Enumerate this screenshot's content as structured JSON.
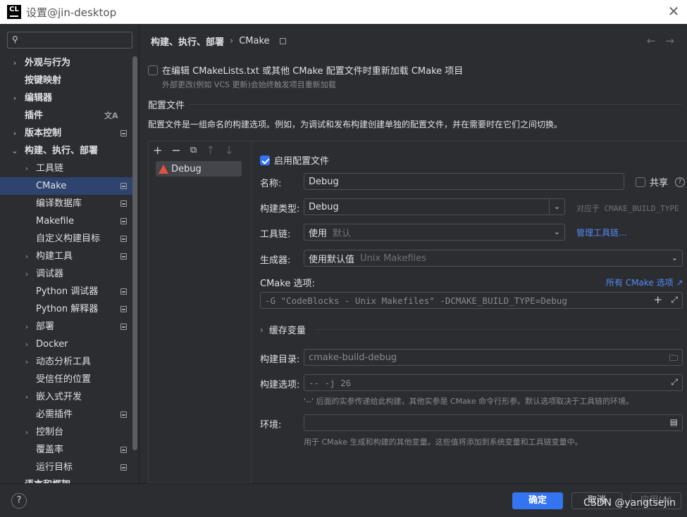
{
  "window": {
    "logo": "CL",
    "title": "设置@jin-desktop",
    "close_glyph": "✕"
  },
  "sidebar": {
    "search_placeholder": "",
    "items": [
      {
        "label": "外观与行为",
        "chevron": "›",
        "bold": true
      },
      {
        "label": "按键映射",
        "bold": true
      },
      {
        "label": "编辑器",
        "chevron": "›",
        "bold": true
      },
      {
        "label": "插件",
        "bold": true,
        "lang_icon": "文A"
      },
      {
        "label": "版本控制",
        "chevron": "›",
        "bold": true
      },
      {
        "label": "构建、执行、部署",
        "chevron": "⌄",
        "bold": true
      },
      {
        "label": "工具链",
        "chevron": "›"
      },
      {
        "label": "CMake",
        "selected": true
      },
      {
        "label": "编译数据库"
      },
      {
        "label": "Makefile"
      },
      {
        "label": "自定义构建目标"
      },
      {
        "label": "构建工具",
        "chevron": "›"
      },
      {
        "label": "调试器",
        "chevron": "›"
      },
      {
        "label": "Python 调试器"
      },
      {
        "label": "Python 解释器"
      },
      {
        "label": "部署",
        "chevron": "›"
      },
      {
        "label": "Docker",
        "chevron": "›"
      },
      {
        "label": "动态分析工具",
        "chevron": "›"
      },
      {
        "label": "受信任的位置"
      },
      {
        "label": "嵌入式开发",
        "chevron": "›"
      },
      {
        "label": "必需插件"
      },
      {
        "label": "控制台",
        "chevron": "›"
      },
      {
        "label": "覆盖率"
      },
      {
        "label": "运行目标"
      },
      {
        "label": "语言和框架",
        "chevron": "›",
        "bold": true
      }
    ]
  },
  "breadcrumb": {
    "parent": "构建、执行、部署",
    "separator": "›",
    "current": "CMake",
    "back": "←",
    "forward": "→"
  },
  "reload": {
    "label": "在编辑 CMakeLists.txt 或其他 CMake 配置文件时重新加载 CMake 项目",
    "hint": "外部更改(例如 VCS 更新)会始终触发项目重新加载",
    "checked": false
  },
  "profiles_section": {
    "title": "配置文件",
    "description": "配置文件是一组命名的构建选项。例如，为调试和发布构建创建单独的配置文件，并在需要时在它们之间切换。",
    "toolbar": {
      "add": "+",
      "remove": "−",
      "copy": "⧉",
      "up": "↑",
      "down": "↓"
    },
    "profiles": [
      "Debug"
    ]
  },
  "profile": {
    "enable_label": "启用配置文件",
    "enabled": true,
    "name_label": "名称:",
    "name_value": "Debug",
    "share_label": "共享",
    "share_help": "?",
    "build_type_label": "构建类型:",
    "build_type_value": "Debug",
    "build_type_note": "对应于 CMAKE_BUILD_TYPE",
    "toolchain_label": "工具链:",
    "toolchain_value": "使用",
    "toolchain_default": "默认",
    "manage_toolchains": "管理工具链...",
    "generator_label": "生成器:",
    "generator_value": "使用默认值",
    "generator_sub": "Unix Makefiles",
    "cmake_options_label": "CMake 选项:",
    "all_cmake_options": "所有 CMake 选项 ↗",
    "cmake_options_value": "-G \"CodeBlocks - Unix Makefiles\" -DCMAKE_BUILD_TYPE=Debug",
    "cache_vars_label": "缓存变量",
    "build_dir_label": "构建目录:",
    "build_dir_value": "cmake-build-debug",
    "build_options_label": "构建选项:",
    "build_options_value": "-- -j 26",
    "build_options_hint": "'--' 后面的实参传递给此构建，其他实参是 CMake 命令行形参。默认选项取决于工具链的环境。",
    "env_label": "环境:",
    "env_value": "",
    "env_hint": "用于 CMake 生成和构建的其他变量。这些值将添加到系统变量和工具链变量中。"
  },
  "footer": {
    "help": "?",
    "ok": "确定",
    "cancel": "取消",
    "apply": "应用(A)",
    "watermark": "CSDN @yangtsejin"
  },
  "colors": {
    "accent": "#3574f0",
    "link": "#548af7",
    "selected_row": "#2e436e",
    "background": "#2b2d30"
  }
}
